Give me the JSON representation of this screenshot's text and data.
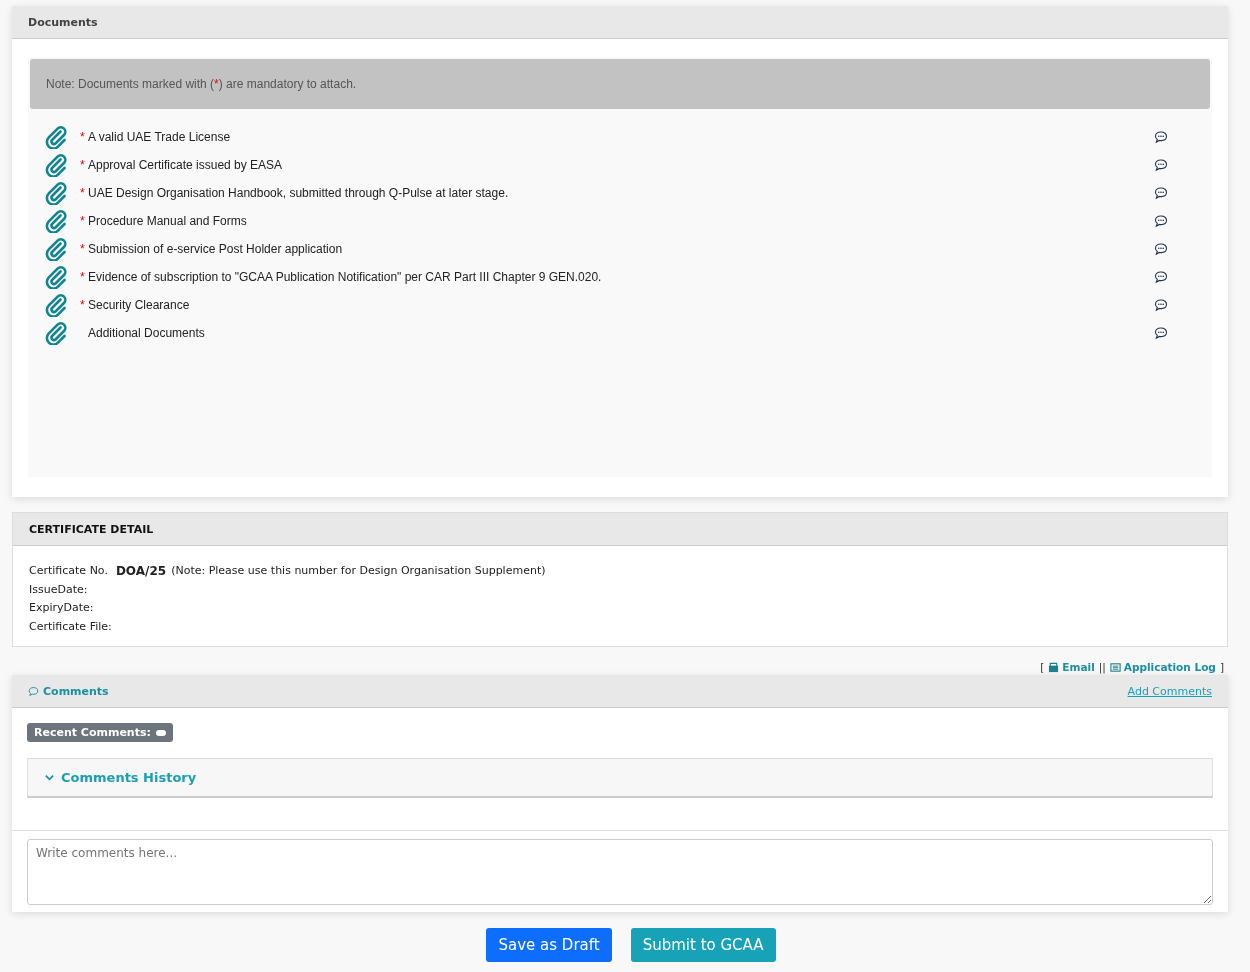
{
  "documents": {
    "title": "Documents",
    "note": {
      "before": "Note: Documents marked with (",
      "mark": "*",
      "after": ") are mandatory to attach."
    },
    "items": [
      {
        "label": "A valid UAE Trade License",
        "mandatory": true,
        "mark": "*"
      },
      {
        "label": "Approval Certificate issued by EASA",
        "mandatory": true,
        "mark": "*"
      },
      {
        "label": "UAE Design Organisation Handbook, submitted through Q-Pulse at later stage.",
        "mandatory": true,
        "mark": "*"
      },
      {
        "label": "Procedure Manual and Forms",
        "mandatory": true,
        "mark": "*"
      },
      {
        "label": "Submission of e-service Post Holder application",
        "mandatory": true,
        "mark": "*"
      },
      {
        "label": "Evidence of subscription to \"GCAA Publication Notification\" per CAR Part III Chapter 9 GEN.020.",
        "mandatory": true,
        "mark": "*"
      },
      {
        "label": "Security Clearance",
        "mandatory": true,
        "mark": "*"
      },
      {
        "label": "Additional Documents",
        "mandatory": false
      }
    ]
  },
  "certificate": {
    "title": "CERTIFICATE DETAIL",
    "number_label": "Certificate No.",
    "number": "DOA/25",
    "number_note": "(Note: Please use this number for Design Organisation Supplement)",
    "fields": [
      "IssueDate:",
      "ExpiryDate:",
      "Certificate File:"
    ]
  },
  "links": {
    "open": "[",
    "email": "Email",
    "separator": "||",
    "log": "Application Log",
    "close": "]"
  },
  "comments": {
    "title": "Comments",
    "add": "Add Comments",
    "recent": "Recent Comments:",
    "history": "Comments History",
    "history_expanded": false,
    "placeholder": "Write comments here..."
  },
  "buttons": [
    {
      "label": "Save as Draft",
      "kind": "primary"
    },
    {
      "label": "Submit to GCAA",
      "kind": "info"
    }
  ]
}
